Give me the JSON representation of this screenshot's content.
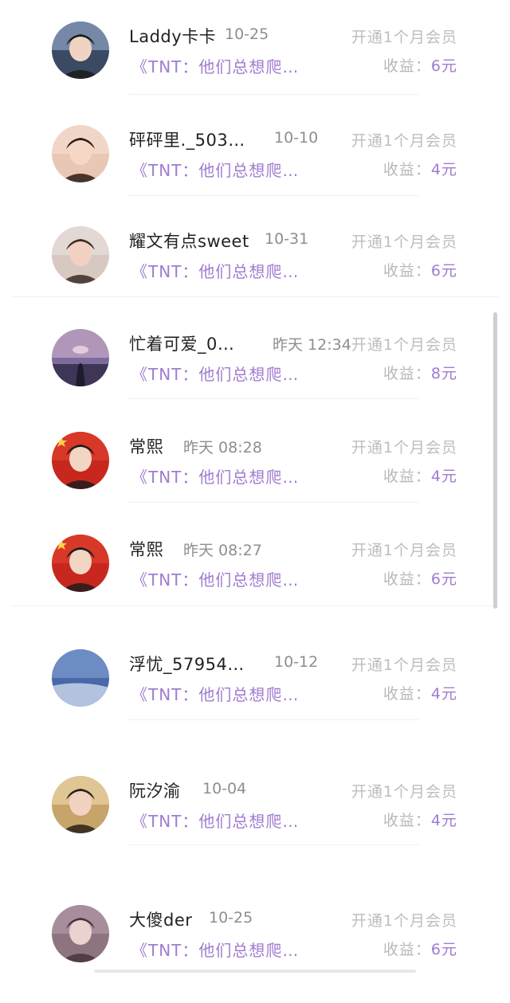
{
  "items": [
    {
      "name": "Laddy卡卡",
      "time": "10-25",
      "action": "开通1个月会员",
      "title": "《TNT：他们总想爬…",
      "earn_label": "收益：",
      "earn_amount": "6元",
      "avatar_icon": "user-avatar-icon"
    },
    {
      "name": "砰砰里._503…",
      "time": "10-10",
      "action": "开通1个月会员",
      "title": "《TNT：他们总想爬…",
      "earn_label": "收益：",
      "earn_amount": "4元",
      "avatar_icon": "user-avatar-icon"
    },
    {
      "name": "耀文有点sweet",
      "time": "10-31",
      "action": "开通1个月会员",
      "title": "《TNT：他们总想爬…",
      "earn_label": "收益：",
      "earn_amount": "6元",
      "avatar_icon": "user-avatar-icon"
    },
    {
      "name": "忙着可爱_0…",
      "time": "昨天 12:34",
      "action": "开通1个月会员",
      "title": "《TNT：他们总想爬…",
      "earn_label": "收益：",
      "earn_amount": "8元",
      "avatar_icon": "user-avatar-icon"
    },
    {
      "name": "常熙",
      "time": "昨天 08:28",
      "action": "开通1个月会员",
      "title": "《TNT：他们总想爬…",
      "earn_label": "收益：",
      "earn_amount": "4元",
      "avatar_icon": "user-avatar-icon"
    },
    {
      "name": "常熙",
      "time": "昨天 08:27",
      "action": "开通1个月会员",
      "title": "《TNT：他们总想爬…",
      "earn_label": "收益：",
      "earn_amount": "6元",
      "avatar_icon": "user-avatar-icon"
    },
    {
      "name": "浮忧_57954…",
      "time": "10-12",
      "action": "开通1个月会员",
      "title": "《TNT：他们总想爬…",
      "earn_label": "收益：",
      "earn_amount": "4元",
      "avatar_icon": "user-avatar-icon"
    },
    {
      "name": "阮汐渝",
      "time": "10-04",
      "action": "开通1个月会员",
      "title": "《TNT：他们总想爬…",
      "earn_label": "收益：",
      "earn_amount": "4元",
      "avatar_icon": "user-avatar-icon"
    },
    {
      "name": "大傻der",
      "time": "10-25",
      "action": "开通1个月会员",
      "title": "《TNT：他们总想爬…",
      "earn_label": "收益：",
      "earn_amount": "6元",
      "avatar_icon": "user-avatar-icon"
    }
  ],
  "colors": {
    "accent": "#a07cd0",
    "muted": "#bdbdbd",
    "time": "#8e8e8e"
  }
}
